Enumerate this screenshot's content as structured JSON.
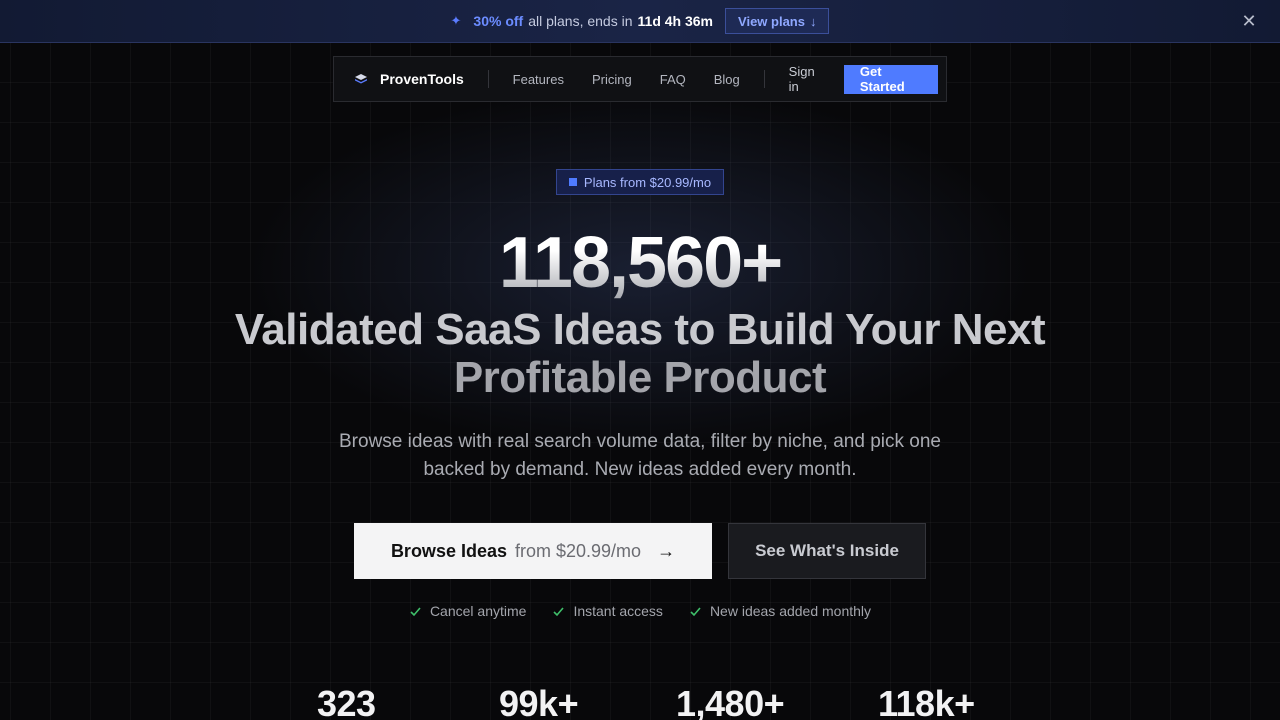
{
  "promo": {
    "discount": "30% off",
    "text": "all plans, ends in",
    "timer": "11d 4h 36m",
    "button": "View plans"
  },
  "nav": {
    "brand": "ProvenTools",
    "links": [
      "Features",
      "Pricing",
      "FAQ",
      "Blog"
    ],
    "signin": "Sign in",
    "cta": "Get Started"
  },
  "hero": {
    "badge": "Plans from $20.99/mo",
    "count": "118,560+",
    "headline_1": "Validated SaaS Ideas to Build Your Next",
    "headline_2": "Profitable Product",
    "subtitle": "Browse ideas with real search volume data, filter by niche, and pick one backed by demand. New ideas added every month.",
    "primary_label": "Browse Ideas",
    "primary_price": "from $20.99/mo",
    "secondary_label": "See What's Inside",
    "checks": [
      "Cancel anytime",
      "Instant access",
      "New ideas added monthly"
    ]
  },
  "stats": [
    "323",
    "99k+",
    "1,480+",
    "118k+"
  ],
  "colors": {
    "accent": "#4f7bff",
    "check": "#3fbf6a"
  }
}
